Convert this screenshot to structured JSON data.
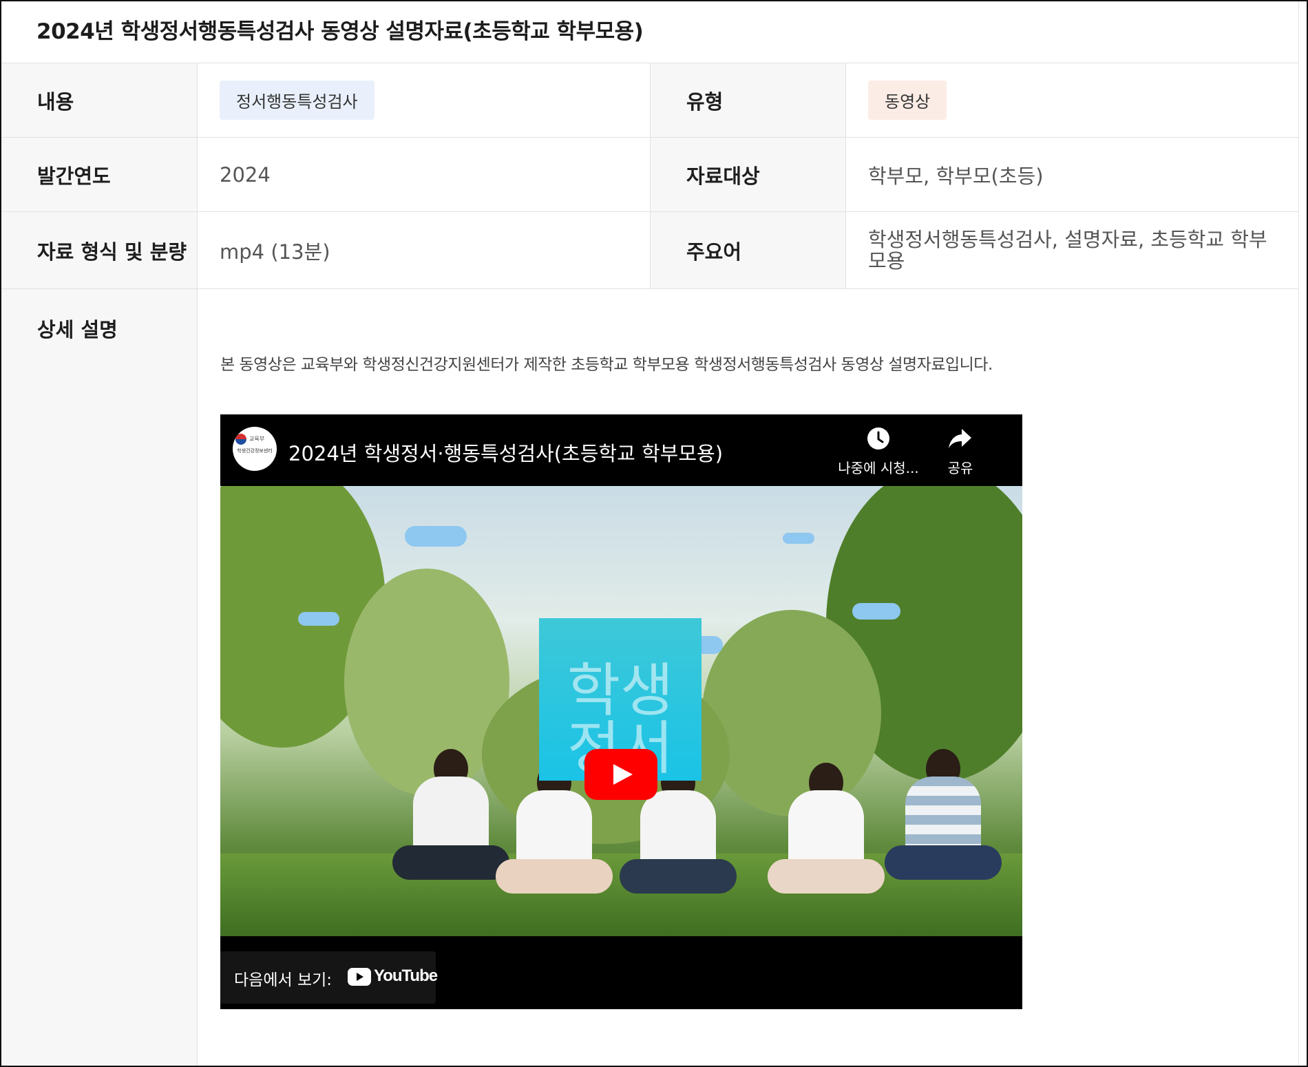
{
  "page": {
    "title": "2024년 학생정서행동특성검사 동영상 설명자료(초등학교 학부모용)"
  },
  "info": {
    "content_label": "내용",
    "content_tag": "정서행동특성검사",
    "type_label": "유형",
    "type_tag": "동영상",
    "year_label": "발간연도",
    "year_value": "2024",
    "target_label": "자료대상",
    "target_value": "학부모, 학부모(초등)",
    "format_label": "자료 형식 및 분량",
    "format_value": "mp4 (13분)",
    "keywords_label": "주요어",
    "keywords_value": "학생정서행동특성검사, 설명자료, 초등학교 학부모용"
  },
  "detail": {
    "label": "상세 설명",
    "description": "본 동영상은 교육부와 학생정신건강지원센터가 제작한 초등학교 학부모용 학생정서행동특성검사 동영상 설명자료입니다."
  },
  "video": {
    "channel_logo_top": "교육부",
    "channel_logo_bottom": "학생건강정보센터",
    "title": "2024년 학생정서·행동특성검사(초등학교 학부모용)",
    "watch_later_label": "나중에 시청...",
    "share_label": "공유",
    "thumbnail_text_top": "학생",
    "thumbnail_text_bottom": "정서",
    "watch_on_label": "다음에서 보기:",
    "youtube_wordmark": "YouTube",
    "icons": [
      "clock-icon",
      "share-icon",
      "play-icon",
      "youtube-logo"
    ],
    "colors": {
      "play_button": "#ff0000",
      "thumbnail_box": "#1ac3e6",
      "tag_blue": "#e9f0fb",
      "tag_peach": "#fcece6"
    }
  }
}
